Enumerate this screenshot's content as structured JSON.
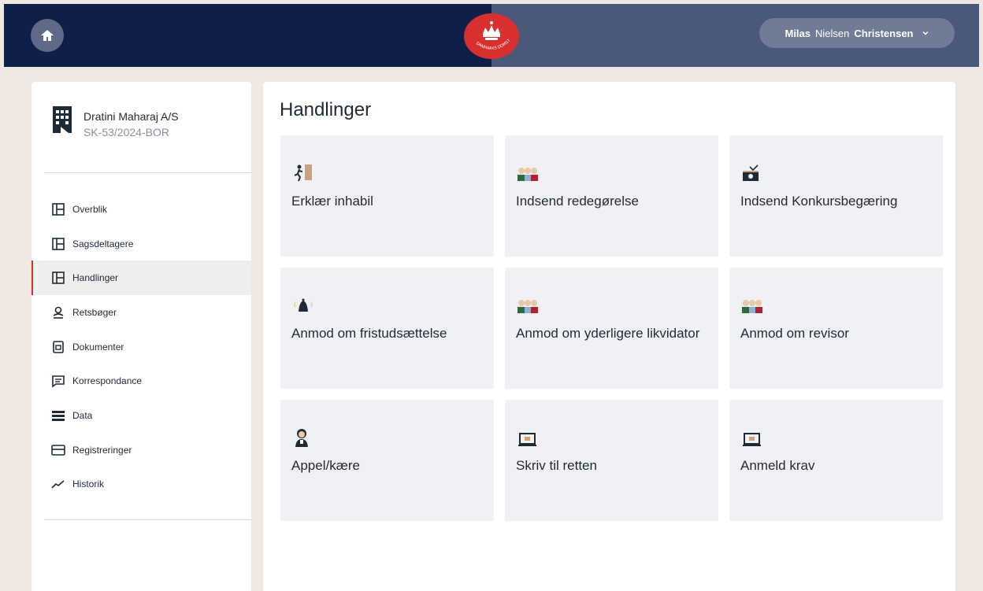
{
  "header": {
    "home_icon": "home-icon",
    "logo_text": "DANMARKS DOMSTOLE",
    "user": {
      "first": "Milas",
      "middle": "Nielsen",
      "last": "Christensen"
    }
  },
  "case": {
    "name": "Dratini Maharaj A/S",
    "id": "SK-53/2024-BOR"
  },
  "sidebar": {
    "items": [
      {
        "label": "Overblik",
        "icon": "panel-icon"
      },
      {
        "label": "Sagsdeltagere",
        "icon": "panel-icon"
      },
      {
        "label": "Handlinger",
        "icon": "panel-icon",
        "active": true
      },
      {
        "label": "Retsbøger",
        "icon": "person-icon"
      },
      {
        "label": "Dokumenter",
        "icon": "document-icon"
      },
      {
        "label": "Korrespondance",
        "icon": "message-icon"
      },
      {
        "label": "Data",
        "icon": "list-icon"
      },
      {
        "label": "Registreringer",
        "icon": "card-icon"
      },
      {
        "label": "Historik",
        "icon": "trend-icon"
      }
    ]
  },
  "main": {
    "title": "Handlinger",
    "cards": [
      {
        "label": "Erklær inhabil",
        "icon": "exit-icon"
      },
      {
        "label": "Indsend redegørelse",
        "icon": "people-icon"
      },
      {
        "label": "Indsend Konkursbegæring",
        "icon": "tv-icon"
      },
      {
        "label": "Anmod om fristudsættelse",
        "icon": "bell-icon"
      },
      {
        "label": "Anmod om yderligere likvidator",
        "icon": "people-icon"
      },
      {
        "label": "Anmod om revisor",
        "icon": "people-icon"
      },
      {
        "label": "Appel/kære",
        "icon": "judge-icon"
      },
      {
        "label": "Skriv til retten",
        "icon": "laptop-icon"
      },
      {
        "label": "Anmeld krav",
        "icon": "laptop-icon"
      }
    ]
  },
  "colors": {
    "topbar_left": "#0f1f4a",
    "topbar_right": "#4a587a",
    "accent_red": "#d8302f",
    "background": "#efe8e2",
    "card_bg": "#f0f1f4"
  }
}
